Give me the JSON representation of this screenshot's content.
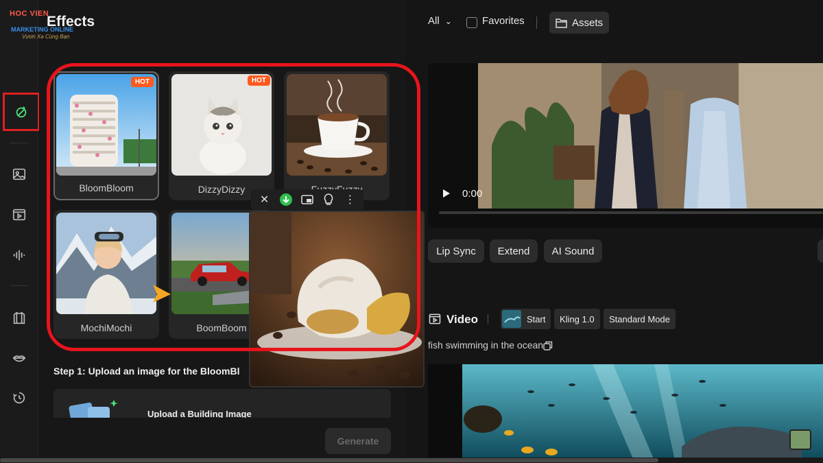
{
  "brand": {
    "name": "HOC VIEN",
    "subtitle": "MARKETING ONLINE",
    "tagline": "Vươn Xa Cùng Bạn"
  },
  "panel": {
    "title": "Effects"
  },
  "effects": [
    {
      "label": "BloomBloom",
      "badge": "HOT"
    },
    {
      "label": "DizzyDizzy",
      "badge": "HOT"
    },
    {
      "label": "FuzzyFuzzy",
      "badge": ""
    },
    {
      "label": "MochiMochi",
      "badge": ""
    },
    {
      "label": "BoomBoom",
      "badge": ""
    }
  ],
  "step": {
    "text": "Step 1: Upload an image for the BloomBl",
    "upload_label": "Upload a Building Image"
  },
  "generate_label": "Generate",
  "topbar": {
    "filter_label": "All",
    "favorites_label": "Favorites",
    "assets_label": "Assets"
  },
  "player": {
    "time": "0:00"
  },
  "actions": {
    "lip_sync": "Lip Sync",
    "extend": "Extend",
    "ai_sound": "AI Sound"
  },
  "video_item": {
    "title": "Video",
    "start_label": "Start",
    "model": "Kling 1.0",
    "mode": "Standard Mode",
    "prompt": "fish swimming in the ocean"
  },
  "colors": {
    "highlight": "#e8141c",
    "hot_badge": "#ff5a1f",
    "download": "#2fbf4f"
  },
  "icons": {
    "rail": [
      "effects-icon",
      "image-icon",
      "video-icon",
      "audio-wave-icon",
      "shirt-icon",
      "lips-icon",
      "history-icon"
    ],
    "toolbar": [
      "close-icon",
      "download-icon",
      "picture-in-picture-icon",
      "lightbulb-icon",
      "more-icon"
    ]
  }
}
